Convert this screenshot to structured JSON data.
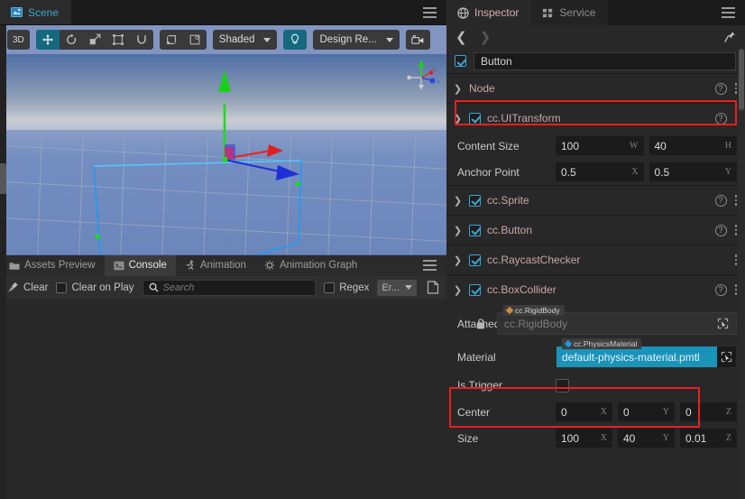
{
  "scene_panel": {
    "tab": {
      "label": "Scene",
      "icon": "scene-icon"
    },
    "menu_icon": "hamburger-icon",
    "toolbar": {
      "mode_button": "3D",
      "transform_tools": [
        {
          "name": "move-tool",
          "icon": "move-icon",
          "active": true
        },
        {
          "name": "rotate-tool",
          "icon": "rotate-icon",
          "active": false
        },
        {
          "name": "scale-tool",
          "icon": "scale-icon",
          "active": false
        },
        {
          "name": "rect-tool",
          "icon": "rect-transform-icon",
          "active": false
        },
        {
          "name": "magnet-tool",
          "icon": "magnet-icon",
          "active": false
        }
      ],
      "pivot_tools": [
        {
          "name": "pivot-toggle",
          "icon": "pivot-icon"
        },
        {
          "name": "coordinate-toggle",
          "icon": "global-local-icon"
        }
      ],
      "shading_select": {
        "value": "Shaded",
        "icon": "chevron-down-icon"
      },
      "light_button": {
        "icon": "bulb-icon",
        "active": true
      },
      "resolution_select": {
        "value": "Design Re...",
        "icon": "chevron-down-icon"
      },
      "camera_button": {
        "icon": "camera-icon"
      }
    },
    "gizmo": {
      "axis_x": "x",
      "axis_y": "y",
      "axis_z": "-z"
    }
  },
  "bottom_panel": {
    "tabs": [
      {
        "label": "Assets Preview",
        "icon": "folder-icon",
        "active": false
      },
      {
        "label": "Console",
        "icon": "terminal-icon",
        "active": true
      },
      {
        "label": "Animation",
        "icon": "animation-icon",
        "active": false
      },
      {
        "label": "Animation Graph",
        "icon": "animation-graph-icon",
        "active": false
      }
    ],
    "menu_icon": "hamburger-icon",
    "console": {
      "clear_label": "Clear",
      "clear_icon": "broom-icon",
      "clear_on_play_label": "Clear on Play",
      "clear_on_play_checked": false,
      "search_placeholder": "Search",
      "search_value": "",
      "search_icon": "search-icon",
      "regex_label": "Regex",
      "regex_checked": false,
      "level_filter": {
        "value": "Er...",
        "icon": "chevron-down-icon"
      },
      "log_file_icon": "document-icon"
    }
  },
  "inspector": {
    "tabs": [
      {
        "label": "Inspector",
        "icon": "inspector-icon",
        "active": true
      },
      {
        "label": "Service",
        "icon": "service-icon",
        "active": false
      }
    ],
    "menu_icon": "hamburger-icon",
    "nav": {
      "back_icon": "chevron-left-icon",
      "forward_icon": "chevron-right-icon",
      "pin_icon": "pin-icon"
    },
    "node": {
      "enabled": true,
      "name": "Button"
    },
    "components": [
      {
        "name": "Node",
        "expanded": false,
        "has_checkbox": false,
        "has_help": true,
        "has_menu": true
      },
      {
        "name": "cc.UITransform",
        "expanded": true,
        "has_checkbox": true,
        "enabled": true,
        "has_help": true,
        "has_menu": true,
        "properties": [
          {
            "label": "Content Size",
            "highlighted": true,
            "fields": [
              {
                "value": "100",
                "axis": "W"
              },
              {
                "value": "40",
                "axis": "H"
              }
            ]
          },
          {
            "label": "Anchor Point",
            "highlighted": false,
            "fields": [
              {
                "value": "0.5",
                "axis": "X"
              },
              {
                "value": "0.5",
                "axis": "Y"
              }
            ]
          }
        ]
      },
      {
        "name": "cc.Sprite",
        "expanded": false,
        "has_checkbox": true,
        "enabled": true,
        "has_help": true,
        "has_menu": true
      },
      {
        "name": "cc.Button",
        "expanded": false,
        "has_checkbox": true,
        "enabled": true,
        "has_help": true,
        "has_menu": true
      },
      {
        "name": "cc.RaycastChecker",
        "expanded": false,
        "has_checkbox": true,
        "enabled": true,
        "has_help": false,
        "has_menu": true
      },
      {
        "name": "cc.BoxCollider",
        "expanded": true,
        "has_checkbox": true,
        "enabled": true,
        "has_help": true,
        "has_menu": true
      }
    ],
    "box_collider": {
      "attached": {
        "label": "Attached",
        "locked": true,
        "lock_icon": "lock-icon",
        "type_tag": "cc.RigidBody",
        "type_tag_color": "#d08a3a",
        "value": "cc.RigidBody",
        "pick_icon": "select-node-icon"
      },
      "material": {
        "label": "Material",
        "type_tag": "cc.PhysicsMaterial",
        "type_tag_color": "#2196d8",
        "value": "default-physics-material.pmtl",
        "selected": true,
        "pick_icon": "select-asset-icon"
      },
      "is_trigger": {
        "label": "Is Trigger",
        "checked": false
      },
      "center": {
        "label": "Center",
        "highlighted": false,
        "fields": [
          {
            "value": "0",
            "axis": "X"
          },
          {
            "value": "0",
            "axis": "Y"
          },
          {
            "value": "0",
            "axis": "Z"
          }
        ]
      },
      "size": {
        "label": "Size",
        "highlighted": true,
        "fields": [
          {
            "value": "100",
            "axis": "X"
          },
          {
            "value": "40",
            "axis": "Y"
          },
          {
            "value": "0.01",
            "axis": "Z"
          }
        ]
      }
    },
    "scrollbar": "vertical-scrollbar"
  },
  "colors": {
    "accent": "#3ba7d6",
    "highlight_border": "#e8201f",
    "selection_fill": "#1a93b8",
    "toolbar_bg": "#8195c0",
    "panel_bg": "#282828",
    "teal_active": "#14697f"
  }
}
